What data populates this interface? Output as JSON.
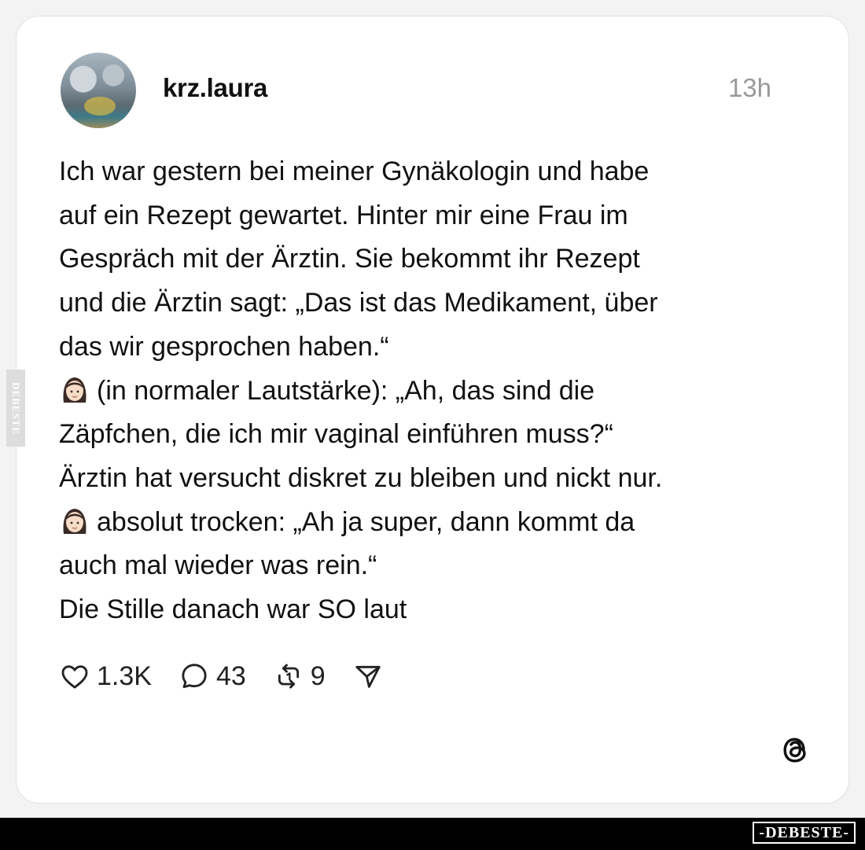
{
  "post": {
    "username": "krz.laura",
    "time": "13h",
    "lines": [
      "Ich war gestern bei meiner Gynäkologin und habe",
      "auf ein Rezept gewartet. Hinter mir eine Frau im",
      "Gespräch mit der Ärztin. Sie bekommt ihr Rezept",
      "und die Ärztin sagt: „Das ist das Medikament, über",
      "das wir gesprochen haben.“",
      "(in normaler Lautstärke): „Ah, das sind die",
      "Zäpfchen, die ich mir vaginal einführen muss?“",
      "Ärztin hat versucht diskret zu bleiben und nickt nur.",
      "absolut trocken: „Ah ja super, dann kommt da",
      "auch mal wieder was rein.“",
      "Die Stille danach war SO laut"
    ],
    "emoji": "woman-emoji"
  },
  "actions": {
    "likes": "1.3K",
    "comments": "43",
    "reposts": "9"
  },
  "icons": {
    "like": "heart-icon",
    "comment": "comment-bubble-icon",
    "repost": "repost-icon",
    "share": "send-icon",
    "logo": "threads-logo-icon"
  },
  "watermark": {
    "side": "DEBESTE",
    "bottom": "-DEBESTE-"
  },
  "colors": {
    "background": "#f3f3f3",
    "card": "#ffffff",
    "text": "#111111",
    "muted": "#999999"
  }
}
